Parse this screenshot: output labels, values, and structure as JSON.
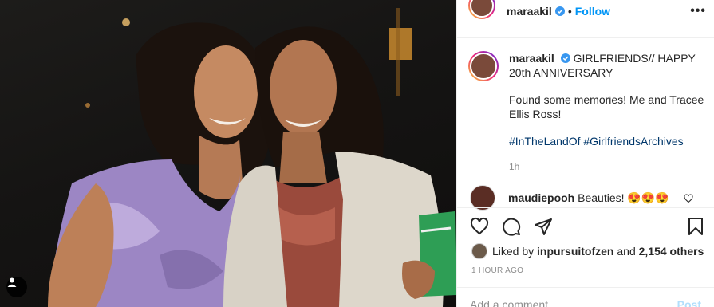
{
  "post": {
    "username": "maraakil",
    "dot": "•",
    "follow_label": "Follow",
    "more_label": "•••",
    "caption_title": "GIRLFRIENDS// HAPPY 20th ANNIVERSARY",
    "caption_body": "Found some memories! Me and Tracee Ellis Ross!",
    "hashtags": "#InTheLandOf #GirlfriendsArchives",
    "caption_time": "1h"
  },
  "comment": {
    "username": "maudiepooh",
    "text": "Beauties! 😍😍😍"
  },
  "likes": {
    "prefix": "Liked by",
    "user": "inpursuitofzen",
    "connector": "and",
    "count": "2,154 others"
  },
  "post_time": "1 HOUR AGO",
  "add_comment_placeholder": "Add a comment...",
  "post_label": "Post",
  "colors": {
    "accent": "#0095f6",
    "hashtag": "#00376b",
    "muted": "#8e8e8e"
  }
}
